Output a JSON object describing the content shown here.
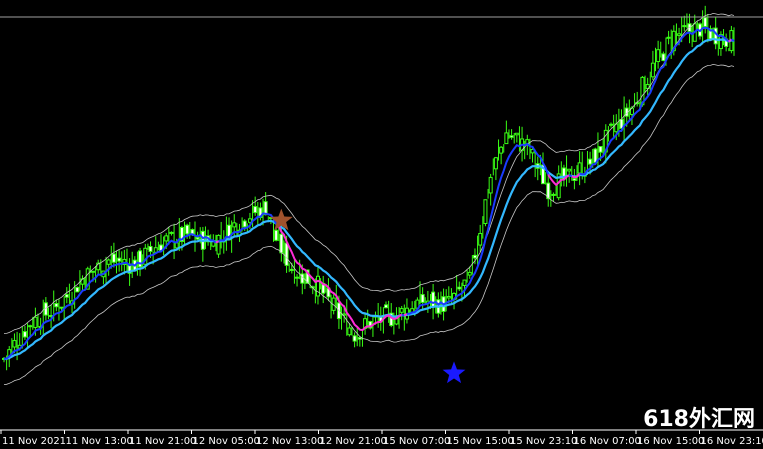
{
  "watermark": "618外汇网",
  "colors": {
    "background": "#000000",
    "candle": "#39ff14",
    "band": "#c8c8c8",
    "fast_up": "#1a3cff",
    "fast_down": "#ff2bd6",
    "slow": "#33b8ff",
    "price_line": "#a0a0a0",
    "axis": "#ffffff",
    "star_sell": "#a0522d",
    "star_buy": "#1a1aff"
  },
  "chart_data": {
    "type": "candlestick",
    "title": "",
    "xlabel": "",
    "ylabel": "",
    "ylim": [
      0,
      100
    ],
    "x_tick_labels": [
      "11 Nov 2021",
      "11 Nov 13:00",
      "11 Nov 21:00",
      "12 Nov 05:00",
      "12 Nov 13:00",
      "12 Nov 21:00",
      "15 Nov 07:00",
      "15 Nov 15:00",
      "15 Nov 23:10",
      "16 Nov 07:00",
      "16 Nov 15:00",
      "16 Nov 23:10"
    ],
    "close_profile": [
      [
        0,
        8
      ],
      [
        10,
        18
      ],
      [
        20,
        22
      ],
      [
        30,
        30
      ],
      [
        40,
        35
      ],
      [
        50,
        34
      ],
      [
        60,
        40
      ],
      [
        70,
        42
      ],
      [
        80,
        40
      ],
      [
        90,
        46
      ],
      [
        100,
        50
      ],
      [
        104,
        41
      ],
      [
        110,
        33
      ],
      [
        120,
        28
      ],
      [
        128,
        20
      ],
      [
        134,
        15
      ],
      [
        140,
        18
      ],
      [
        150,
        20
      ],
      [
        160,
        24
      ],
      [
        170,
        23
      ],
      [
        178,
        30
      ],
      [
        186,
        58
      ],
      [
        192,
        70
      ],
      [
        200,
        66
      ],
      [
        208,
        55
      ],
      [
        216,
        58
      ],
      [
        224,
        62
      ],
      [
        232,
        70
      ],
      [
        240,
        77
      ],
      [
        248,
        88
      ],
      [
        256,
        97
      ],
      [
        266,
        99
      ],
      [
        279,
        95
      ]
    ],
    "candle_count": 280,
    "last_price": 99,
    "markers": [
      {
        "type": "star",
        "signal": "sell",
        "color": "#a0522d",
        "bar": 106,
        "value": 46
      },
      {
        "type": "star",
        "signal": "buy",
        "color": "#1a1aff",
        "bar": 172,
        "value": 4
      }
    ],
    "series": [
      {
        "role": "fast-ma",
        "color_up": "#1a3cff",
        "color_down": "#ff2bd6"
      },
      {
        "role": "slow-ma",
        "color": "#33b8ff"
      },
      {
        "role": "upper-band",
        "color": "#c8c8c8"
      },
      {
        "role": "lower-band",
        "color": "#c8c8c8"
      }
    ],
    "grid": false,
    "legend": "none"
  }
}
